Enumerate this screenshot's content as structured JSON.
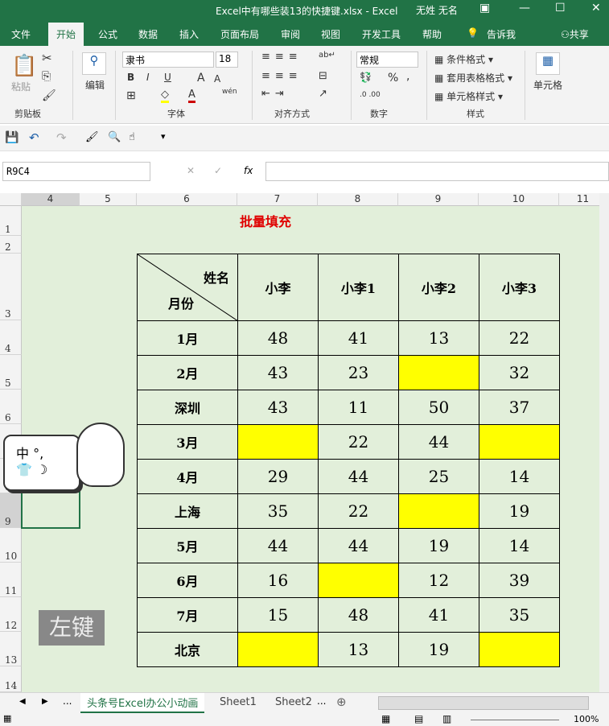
{
  "title": "Excel中有哪些装13的快捷键.xlsx  -  Excel",
  "user": "无姓 无名",
  "tabs": [
    "文件",
    "开始",
    "公式",
    "数据",
    "插入",
    "页面布局",
    "审阅",
    "视图",
    "开发工具",
    "帮助",
    "告诉我",
    "共享"
  ],
  "ribbon": {
    "paste": "粘贴",
    "clipboard": "剪贴板",
    "edit": "编辑",
    "font_name": "隶书",
    "font_size": "18",
    "font": "字体",
    "bold": "B",
    "italic": "I",
    "underline": "U",
    "wen": "wén",
    "align": "对齐方式",
    "num_format": "常规",
    "number": "数字",
    "percent": "%",
    "comma": ",",
    "cond": "条件格式",
    "table_fmt": "套用表格格式",
    "cell_style": "单元格样式",
    "styles": "样式",
    "cells": "单元格"
  },
  "name_box": "R9C4",
  "fx": "fx",
  "columns": [
    "4",
    "5",
    "6",
    "7",
    "8",
    "9",
    "10",
    "11"
  ],
  "rows": [
    "1",
    "2",
    "3",
    "4",
    "5",
    "6",
    "7",
    "8",
    "9",
    "10",
    "11",
    "12",
    "13",
    "14"
  ],
  "sheet_title": "批量填充",
  "table": {
    "header_top": "姓名",
    "header_bottom": "月份",
    "names": [
      "小李",
      "小李1",
      "小李2",
      "小李3"
    ],
    "rows": [
      {
        "label": "1月",
        "values": [
          "48",
          "41",
          "13",
          "22"
        ]
      },
      {
        "label": "2月",
        "values": [
          "43",
          "23",
          "",
          "32"
        ]
      },
      {
        "label": "深圳",
        "values": [
          "43",
          "11",
          "50",
          "37"
        ]
      },
      {
        "label": "3月",
        "values": [
          "",
          "22",
          "44",
          ""
        ]
      },
      {
        "label": "4月",
        "values": [
          "29",
          "44",
          "25",
          "14"
        ]
      },
      {
        "label": "上海",
        "values": [
          "35",
          "22",
          "",
          "19"
        ]
      },
      {
        "label": "5月",
        "values": [
          "44",
          "44",
          "19",
          "14"
        ]
      },
      {
        "label": "6月",
        "values": [
          "16",
          "",
          "12",
          "39"
        ]
      },
      {
        "label": "7月",
        "values": [
          "15",
          "48",
          "41",
          "35"
        ]
      },
      {
        "label": "北京",
        "values": [
          "",
          "13",
          "19",
          ""
        ]
      }
    ]
  },
  "ime": {
    "line1": "中 °,",
    "line2": "👕 ☽"
  },
  "key_overlay": "左键",
  "sheets": [
    "头条号Excel办公小动画",
    "Sheet1",
    "Sheet2"
  ],
  "more": "...",
  "zoom": "100%",
  "colors": {
    "green": "#217346",
    "cell_bg": "#e2efda",
    "yellow": "#ffff00",
    "title_red": "#e00000"
  }
}
